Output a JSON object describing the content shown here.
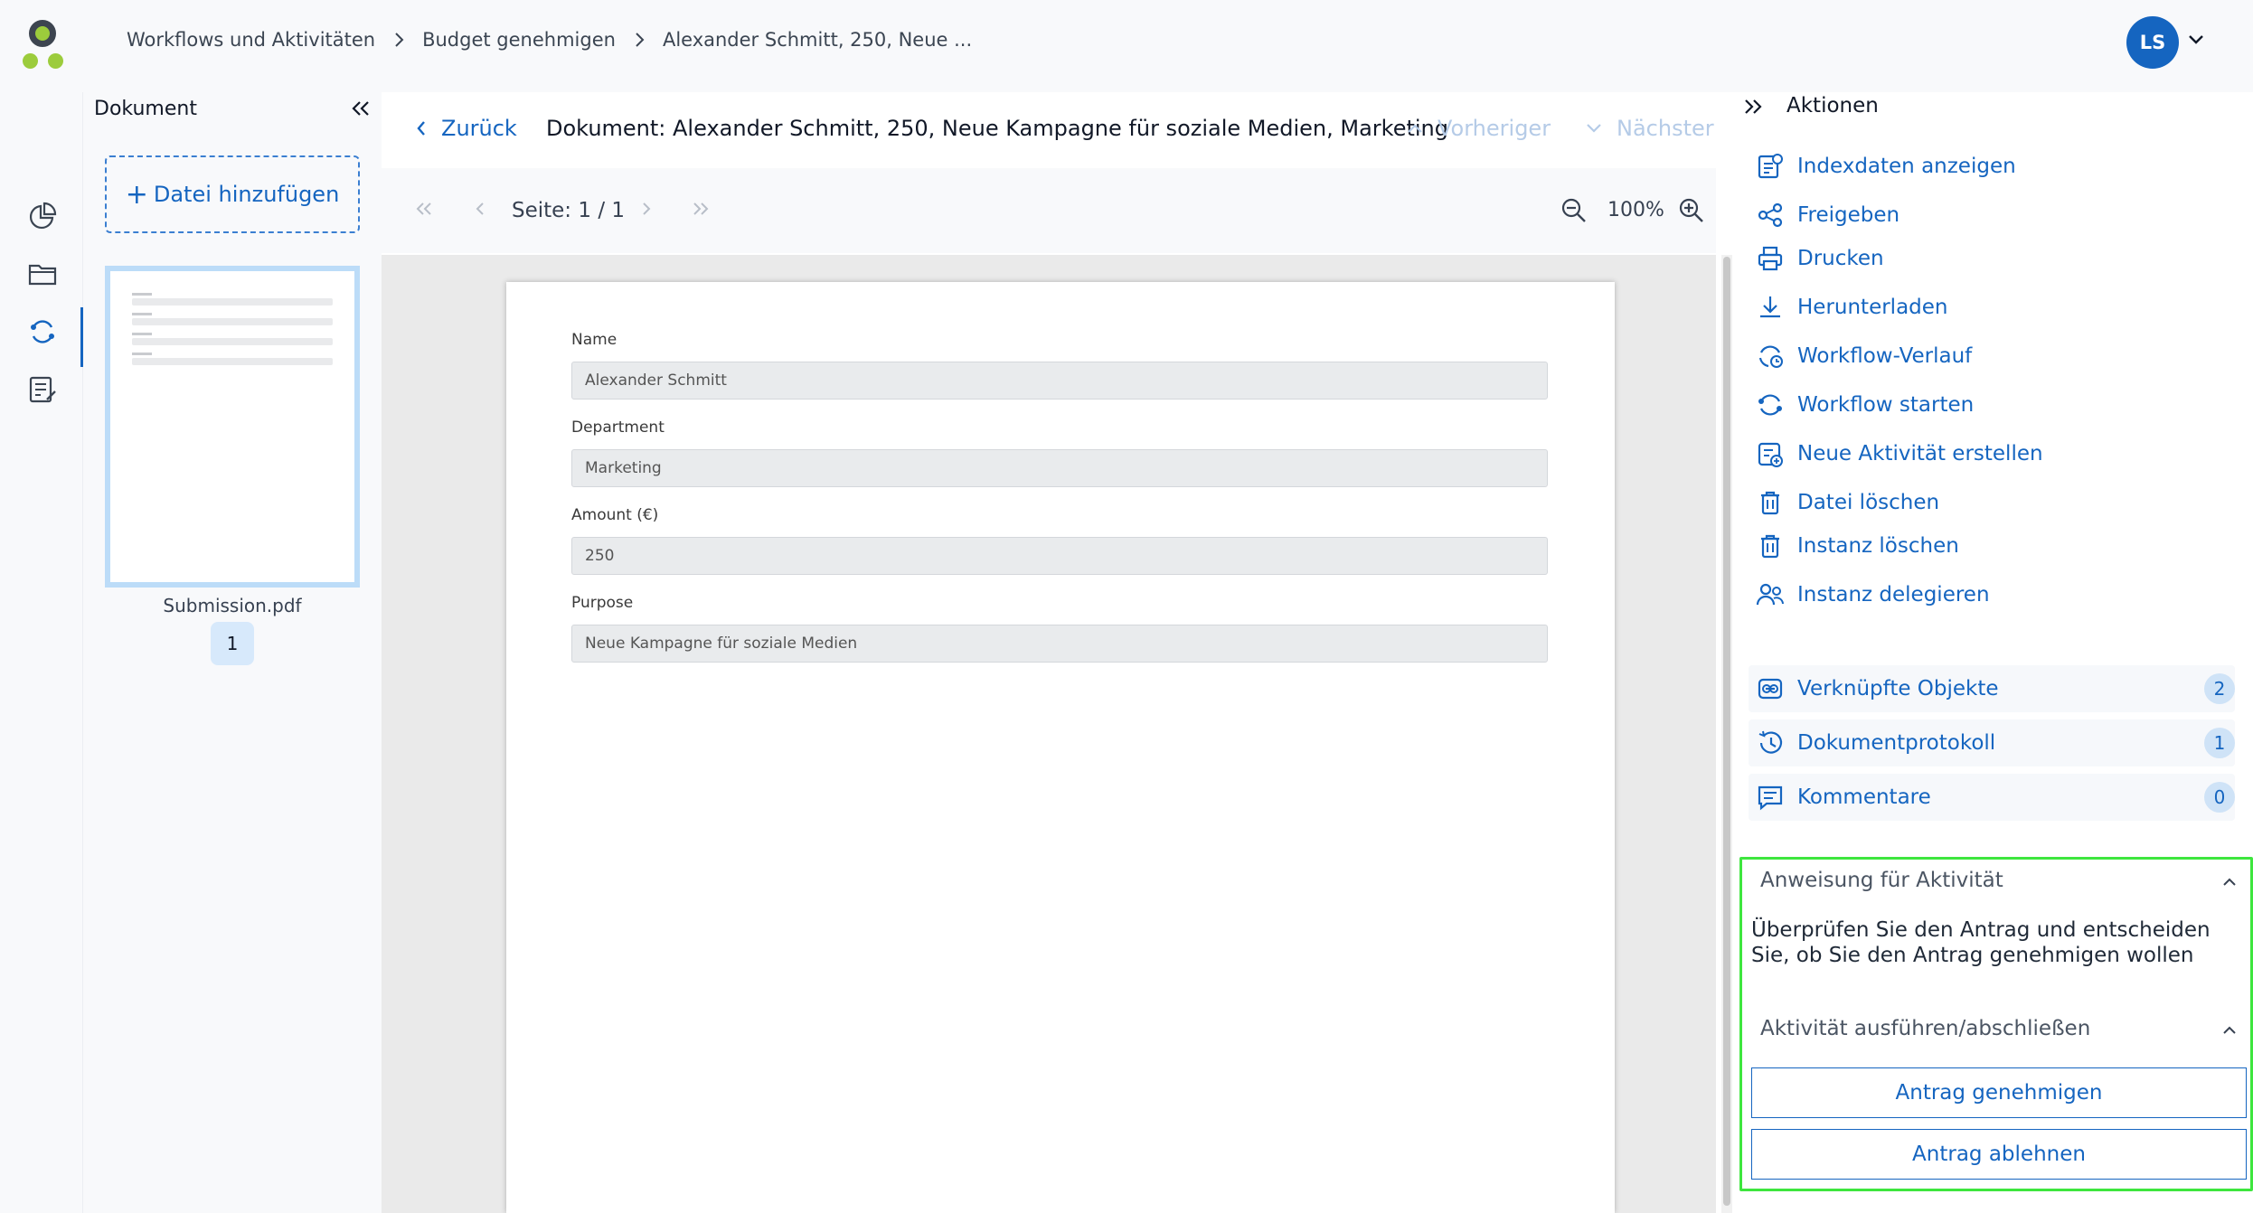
{
  "breadcrumb": [
    "Workflows und Aktivitäten",
    "Budget genehmigen",
    "Alexander Schmitt, 250, Neue ..."
  ],
  "user": {
    "initials": "LS"
  },
  "doc_panel": {
    "title": "Dokument",
    "add_file_label": "Datei hinzufügen",
    "file_name": "Submission.pdf",
    "page_number": "1"
  },
  "viewer": {
    "back_label": "Zurück",
    "title": "Dokument: Alexander Schmitt, 250, Neue Kampagne für soziale Medien, Marketing",
    "prev_label": "Vorheriger",
    "next_label": "Nächster",
    "page_label": "Seite: 1 / 1",
    "zoom": "100%"
  },
  "form": {
    "fields": [
      {
        "label": "Name",
        "value": "Alexander Schmitt"
      },
      {
        "label": "Department",
        "value": "Marketing"
      },
      {
        "label": "Amount (€)",
        "value": "250"
      },
      {
        "label": "Purpose",
        "value": "Neue Kampagne für soziale Medien"
      }
    ]
  },
  "actions": {
    "title": "Aktionen",
    "items": [
      {
        "label": "Indexdaten anzeigen",
        "icon": "index-data-icon"
      },
      {
        "label": "Freigeben",
        "icon": "share-icon"
      },
      {
        "label": "Drucken",
        "icon": "print-icon"
      },
      {
        "label": "Herunterladen",
        "icon": "download-icon"
      },
      {
        "label": "Workflow-Verlauf",
        "icon": "workflow-history-icon"
      },
      {
        "label": "Workflow starten",
        "icon": "workflow-start-icon"
      },
      {
        "label": "Neue Aktivität erstellen",
        "icon": "new-activity-icon"
      },
      {
        "label": "Datei löschen",
        "icon": "trash-icon"
      },
      {
        "label": "Instanz löschen",
        "icon": "trash-icon"
      },
      {
        "label": "Instanz delegieren",
        "icon": "delegate-icon"
      }
    ],
    "linked": [
      {
        "label": "Verknüpfte Objekte",
        "count": "2",
        "icon": "link-icon"
      },
      {
        "label": "Dokumentprotokoll",
        "count": "1",
        "icon": "history-icon"
      },
      {
        "label": "Kommentare",
        "count": "0",
        "icon": "comment-icon"
      }
    ]
  },
  "instruction": {
    "heading": "Anweisung für Aktivität",
    "text": "Überprüfen Sie den Antrag und entscheiden Sie, ob Sie den Antrag genehmigen wollen",
    "execute_heading": "Aktivität ausführen/abschließen",
    "approve_label": "Antrag genehmigen",
    "reject_label": "Antrag ablehnen"
  },
  "colors": {
    "accent": "#1565c0",
    "highlight": "#3ee63e",
    "brand_green": "#9ccc3c"
  }
}
